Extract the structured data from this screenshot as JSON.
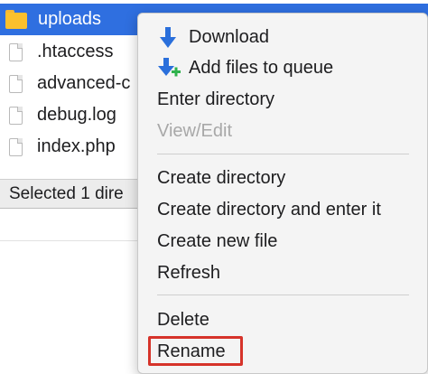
{
  "file_list": {
    "rows": [
      {
        "name": "uploads",
        "type": "folder",
        "selected": true
      },
      {
        "name": ".htaccess",
        "type": "file",
        "selected": false
      },
      {
        "name": "advanced-c",
        "type": "file",
        "selected": false
      },
      {
        "name": "debug.log",
        "type": "file",
        "selected": false
      },
      {
        "name": "index.php",
        "type": "file",
        "selected": false
      }
    ]
  },
  "status_bar": {
    "text": "Selected 1 dire"
  },
  "context_menu": {
    "items": [
      {
        "label": "Download",
        "icon": "download-arrow-icon",
        "enabled": true
      },
      {
        "label": "Add files to queue",
        "icon": "add-to-queue-icon",
        "enabled": true
      },
      {
        "label": "Enter directory",
        "enabled": true
      },
      {
        "label": "View/Edit",
        "enabled": false
      },
      {
        "label": "Create directory",
        "enabled": true
      },
      {
        "label": "Create directory and enter it",
        "enabled": true
      },
      {
        "label": "Create new file",
        "enabled": true
      },
      {
        "label": "Refresh",
        "enabled": true
      },
      {
        "label": "Delete",
        "enabled": true
      },
      {
        "label": "Rename",
        "enabled": true,
        "highlighted": true
      }
    ]
  },
  "colors": {
    "selection": "#2f6fe0",
    "folder": "#fbc02d",
    "download_icon": "#2a6fdb",
    "plus_icon": "#2fb24c",
    "highlight_border": "#d6332a",
    "disabled_text": "#a8a8a8"
  }
}
